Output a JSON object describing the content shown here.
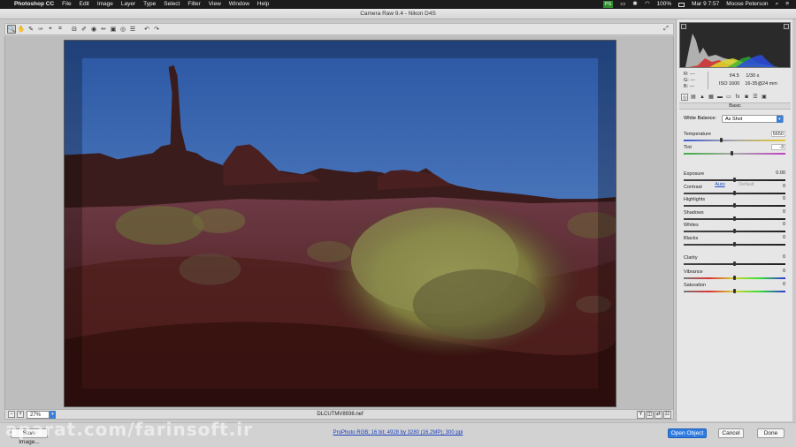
{
  "menubar": {
    "app": "Photoshop CC",
    "items": [
      "File",
      "Edit",
      "Image",
      "Layer",
      "Type",
      "Select",
      "Filter",
      "View",
      "Window",
      "Help"
    ],
    "battery": "100%",
    "clock": "Mar 9  7:57",
    "user": "Moose Peterson",
    "ps_badge": "PS"
  },
  "window": {
    "title": "Camera Raw 9.4  -  Nikon D4S"
  },
  "toolbar": {
    "tools": [
      {
        "name": "zoom-tool",
        "glyph": "🔍",
        "active": true
      },
      {
        "name": "hand-tool",
        "glyph": "✋"
      },
      {
        "name": "white-balance-tool",
        "glyph": "✎"
      },
      {
        "name": "color-sampler-tool",
        "glyph": "✑"
      },
      {
        "name": "targeted-adjustment-tool",
        "glyph": "⌖"
      },
      {
        "name": "crop-tool",
        "glyph": "⌗"
      },
      {
        "name": "straighten-tool",
        "glyph": "⊟"
      },
      {
        "name": "spot-removal-tool",
        "glyph": "✐"
      },
      {
        "name": "red-eye-tool",
        "glyph": "◉"
      },
      {
        "name": "adjustment-brush-tool",
        "glyph": "✏"
      },
      {
        "name": "graduated-filter-tool",
        "glyph": "▣"
      },
      {
        "name": "radial-filter-tool",
        "glyph": "◎"
      },
      {
        "name": "preferences-tool",
        "glyph": "☰"
      },
      {
        "name": "rotate-left-tool",
        "glyph": "↶"
      },
      {
        "name": "rotate-right-tool",
        "glyph": "↷"
      }
    ]
  },
  "status": {
    "zoom": "27%",
    "filename": "DLCUTMV8936.nef"
  },
  "workflow": "ProPhoto RGB; 16 bit; 4928 by 3280 (16.2MP); 300 ppi",
  "buttons": {
    "save": "Save Image...",
    "open": "Open Object",
    "cancel": "Cancel",
    "done": "Done"
  },
  "watermark": "aparat.com/farinsoft.ir",
  "readout": {
    "r": "R:   ---",
    "g": "G:   ---",
    "b": "B:   ---",
    "aperture": "f/4.5",
    "shutter": "1/30 s",
    "iso": "ISO 1600",
    "lens": "16-35@24 mm"
  },
  "panel": {
    "section": "Basic",
    "white_balance_label": "White Balance:",
    "white_balance_value": "As Shot",
    "auto": "Auto",
    "default": "Default",
    "sliders": [
      {
        "key": "temperature",
        "label": "Temperature",
        "value": "5650",
        "pos": 0.37,
        "track": "temp",
        "boxed": true
      },
      {
        "key": "tint",
        "label": "Tint",
        "value": "-3",
        "pos": 0.47,
        "track": "tint",
        "boxed": true
      },
      {
        "key": "exposure",
        "label": "Exposure",
        "value": "0.00",
        "pos": 0.5
      },
      {
        "key": "contrast",
        "label": "Contrast",
        "value": "0",
        "pos": 0.5
      },
      {
        "key": "highlights",
        "label": "Highlights",
        "value": "0",
        "pos": 0.5
      },
      {
        "key": "shadows",
        "label": "Shadows",
        "value": "0",
        "pos": 0.5
      },
      {
        "key": "whites",
        "label": "Whites",
        "value": "0",
        "pos": 0.5
      },
      {
        "key": "blacks",
        "label": "Blacks",
        "value": "0",
        "pos": 0.5
      },
      {
        "key": "clarity",
        "label": "Clarity",
        "value": "0",
        "pos": 0.5
      },
      {
        "key": "vibrance",
        "label": "Vibrance",
        "value": "0",
        "pos": 0.5,
        "track": "vib"
      },
      {
        "key": "saturation",
        "label": "Saturation",
        "value": "0",
        "pos": 0.5,
        "track": "vib"
      }
    ]
  }
}
